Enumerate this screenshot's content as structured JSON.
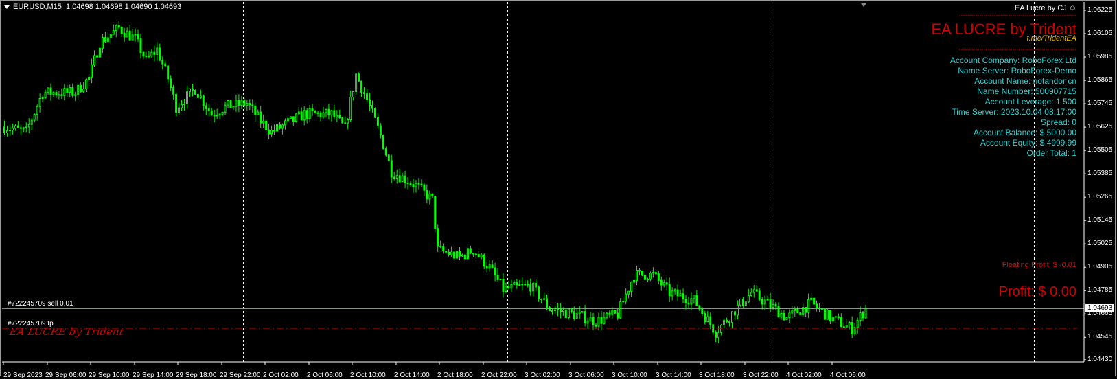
{
  "header": {
    "symbol": "EURUSD,M15",
    "ohlc": "1.04698 1.04698 1.04690 1.04693"
  },
  "panel": {
    "ea_small": "EA Lucre by CJ",
    "title": "EA LUCRE by Trident",
    "link": "t.me/TridentEA",
    "info": [
      "Account Company: RoboForex Ltd",
      "Name Server: RoboForex-Demo",
      "Account Name: notandor cn",
      "Name Number: 500907715",
      "Account Leverage: 1 500",
      "Time Server: 2023.10.04 08:17:00",
      "Spread: 0",
      "Account Balance: $ 5000.00",
      "Account Equity: $ 4999.99",
      "Order Total: 1"
    ],
    "floating_profit": "Floating Profit: $ -0.01",
    "profit": "Profit: $ 0.00"
  },
  "orders": {
    "sell_label": "#722245709 sell 0.01",
    "sell_price": 1.04693,
    "tp_label": "#722245709 tp",
    "tp_price": 1.04592
  },
  "logo_text": "EA LUCRE by Trident",
  "colors": {
    "candle": "#00ff00",
    "accent_red": "#d40000",
    "info_cyan": "#2fd0d0",
    "price_line": "#7fbf7f"
  },
  "chart_data": {
    "type": "candlestick",
    "symbol": "EURUSD",
    "timeframe": "M15",
    "current_price": "1.04693",
    "ylim": [
      1.0443,
      1.06225
    ],
    "y_ticks": [
      "1.06225",
      "1.06105",
      "1.05985",
      "1.05865",
      "1.05745",
      "1.05625",
      "1.05505",
      "1.05385",
      "1.05265",
      "1.05145",
      "1.05025",
      "1.04905",
      "1.04785",
      "1.04665",
      "1.04545",
      "1.04430"
    ],
    "x_ticks": [
      "29 Sep 2023",
      "29 Sep 06:00",
      "29 Sep 10:00",
      "29 Sep 14:00",
      "29 Sep 18:00",
      "29 Sep 22:00",
      "2 Oct 02:00",
      "2 Oct 06:00",
      "2 Oct 10:00",
      "2 Oct 14:00",
      "2 Oct 18:00",
      "2 Oct 22:00",
      "3 Oct 02:00",
      "3 Oct 06:00",
      "3 Oct 10:00",
      "3 Oct 14:00",
      "3 Oct 18:00",
      "3 Oct 22:00",
      "4 Oct 02:00",
      "4 Oct 06:00"
    ],
    "bars_per_tick": 16,
    "day_separators_bar": [
      88,
      185,
      281,
      378
    ],
    "close_path": [
      [
        0,
        1.05626
      ],
      [
        8,
        1.056
      ],
      [
        14,
        1.05802
      ],
      [
        26,
        1.05802
      ],
      [
        31,
        1.05876
      ],
      [
        35,
        1.0606
      ],
      [
        42,
        1.06133
      ],
      [
        48,
        1.06078
      ],
      [
        52,
        1.05968
      ],
      [
        56,
        1.06023
      ],
      [
        60,
        1.05876
      ],
      [
        63,
        1.05729
      ],
      [
        70,
        1.05821
      ],
      [
        76,
        1.05692
      ],
      [
        81,
        1.05729
      ],
      [
        89,
        1.05747
      ],
      [
        94,
        1.05656
      ],
      [
        98,
        1.056
      ],
      [
        110,
        1.05692
      ],
      [
        120,
        1.05692
      ],
      [
        125,
        1.05619
      ],
      [
        129,
        1.05894
      ],
      [
        133,
        1.05766
      ],
      [
        138,
        1.05582
      ],
      [
        142,
        1.05398
      ],
      [
        151,
        1.05325
      ],
      [
        157,
        1.05251
      ],
      [
        159,
        1.04994
      ],
      [
        167,
        1.04957
      ],
      [
        172,
        1.04994
      ],
      [
        178,
        1.04902
      ],
      [
        183,
        1.04792
      ],
      [
        193,
        1.04811
      ],
      [
        200,
        1.04693
      ],
      [
        209,
        1.04664
      ],
      [
        217,
        1.04627
      ],
      [
        225,
        1.04664
      ],
      [
        231,
        1.04866
      ],
      [
        238,
        1.04866
      ],
      [
        244,
        1.04774
      ],
      [
        253,
        1.04737
      ],
      [
        261,
        1.04572
      ],
      [
        269,
        1.047
      ],
      [
        274,
        1.04774
      ],
      [
        282,
        1.047
      ],
      [
        287,
        1.04645
      ],
      [
        296,
        1.04719
      ],
      [
        303,
        1.04645
      ],
      [
        311,
        1.0459
      ],
      [
        316,
        1.04693
      ]
    ]
  }
}
